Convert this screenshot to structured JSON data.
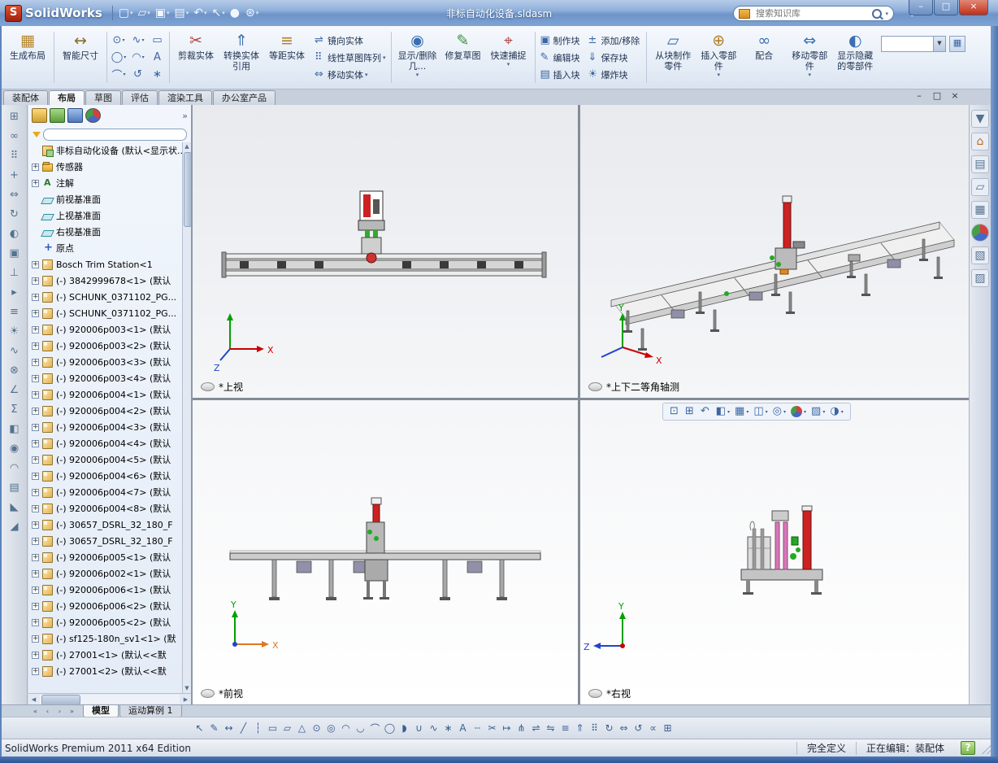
{
  "titlebar": {
    "app_name": "SolidWorks",
    "doc_title": "非标自动化设备.sldasm",
    "search_placeholder": "搜索知识库",
    "help_label": "?",
    "buttons": [
      {
        "name": "new-document-button",
        "glyph": "▢",
        "arrow": "▾"
      },
      {
        "name": "open-document-button",
        "glyph": "▱",
        "arrow": "▾"
      },
      {
        "name": "save-document-button",
        "glyph": "▣",
        "arrow": "▾"
      },
      {
        "name": "print-button",
        "glyph": "▤",
        "arrow": "▾"
      },
      {
        "name": "undo-button",
        "glyph": "↶",
        "arrow": "▾"
      },
      {
        "name": "select-button",
        "glyph": "↖",
        "arrow": "▾"
      },
      {
        "name": "rebuild-button",
        "glyph": "●",
        "arrow": ""
      },
      {
        "name": "options-button",
        "glyph": "⊛",
        "arrow": "▾"
      }
    ],
    "window_buttons": [
      {
        "name": "minimize-button",
        "glyph": "–",
        "cls": ""
      },
      {
        "name": "maximize-button",
        "glyph": "□",
        "cls": ""
      },
      {
        "name": "close-button",
        "glyph": "×",
        "cls": "close"
      }
    ]
  },
  "ribbon": {
    "g1": [
      {
        "name": "create-layout-button",
        "glyph": "▦",
        "color": "#b5862e",
        "label": "生成布局",
        "arrow": ""
      }
    ],
    "g2": [
      {
        "name": "smart-dimension-button",
        "glyph": "↔",
        "color": "#8a6d2f",
        "label": "智能尺寸",
        "arrow": ""
      }
    ],
    "grid": [
      {
        "name": "circle-tool-icon",
        "glyph": "⊙",
        "arrow": "▾"
      },
      {
        "name": "spline-tool-icon",
        "glyph": "∿",
        "arrow": "▾"
      },
      {
        "name": "rectangle-tool-icon",
        "glyph": "▭",
        "arrow": ""
      },
      {
        "name": "ellipse-tool-icon",
        "glyph": "◯",
        "arrow": "▾"
      },
      {
        "name": "arc-tool-icon",
        "glyph": "◠",
        "arrow": "▾"
      },
      {
        "name": "text-tool-icon",
        "glyph": "A",
        "arrow": ""
      },
      {
        "name": "slot-tool-icon",
        "glyph": "⌒",
        "arrow": "▾"
      },
      {
        "name": "erase-tool-icon",
        "glyph": "↺",
        "arrow": ""
      },
      {
        "name": "point-tool-icon",
        "glyph": "∗",
        "arrow": ""
      }
    ],
    "g4": [
      {
        "name": "trim-entities-button",
        "glyph": "✂",
        "color": "#b04040",
        "label": "剪裁实体",
        "arrow": ""
      },
      {
        "name": "convert-entities-button",
        "glyph": "⇑",
        "color": "#3a6fb0",
        "label": "转换实体引用",
        "arrow": ""
      },
      {
        "name": "offset-entities-button",
        "glyph": "≡",
        "color": "#b08030",
        "label": "等距实体",
        "arrow": ""
      }
    ],
    "g5": [
      {
        "name": "mirror-entities-button",
        "glyph": "⇌",
        "label": "镜向实体",
        "arrow": ""
      },
      {
        "name": "linear-sketch-pattern-button",
        "glyph": "⠿",
        "label": "线性草图阵列",
        "arrow": "▾"
      },
      {
        "name": "move-entities-button",
        "glyph": "⇔",
        "label": "移动实体",
        "arrow": "▾"
      }
    ],
    "g6": [
      {
        "name": "display-delete-relations-button",
        "glyph": "◉",
        "color": "#3a6fb0",
        "label": "显示/删除几...",
        "arrow": "▾"
      },
      {
        "name": "repair-sketch-button",
        "glyph": "✎",
        "color": "#3f8f3f",
        "label": "修复草图",
        "arrow": ""
      },
      {
        "name": "quick-snaps-button",
        "glyph": "⌖",
        "color": "#b04040",
        "label": "快速捕捉",
        "arrow": "▾"
      }
    ],
    "g7": [
      {
        "name": "make-block-button",
        "glyph": "▣",
        "label": "制作块",
        "arrow": ""
      },
      {
        "name": "edit-block-button",
        "glyph": "✎",
        "label": "编辑块",
        "arrow": ""
      },
      {
        "name": "insert-block-button",
        "glyph": "▤",
        "label": "插入块",
        "arrow": ""
      }
    ],
    "g8": [
      {
        "name": "add-remove-block-button",
        "glyph": "±",
        "label": "添加/移除",
        "arrow": ""
      },
      {
        "name": "save-block-button",
        "glyph": "⇓",
        "label": "保存块",
        "arrow": ""
      },
      {
        "name": "explode-block-button",
        "glyph": "☀",
        "label": "爆炸块",
        "arrow": ""
      }
    ],
    "g9": [
      {
        "name": "make-part-from-block-button",
        "glyph": "▱",
        "color": "#3a6fb0",
        "label": "从块制作零件",
        "arrow": ""
      },
      {
        "name": "insert-components-button",
        "glyph": "⊕",
        "color": "#b08030",
        "label": "插入零部件",
        "arrow": "▾"
      },
      {
        "name": "mate-button",
        "glyph": "∞",
        "color": "#3a6fb0",
        "label": "配合",
        "arrow": ""
      },
      {
        "name": "move-component-button",
        "glyph": "⇔",
        "color": "#3a6fb0",
        "label": "移动零部件",
        "arrow": "▾"
      },
      {
        "name": "show-hidden-components-button",
        "glyph": "◐",
        "color": "#3a6fb0",
        "label": "显示隐藏的零部件",
        "arrow": ""
      }
    ]
  },
  "mode_tabs": [
    {
      "label": "装配体",
      "cls": ""
    },
    {
      "label": "布局",
      "cls": "active"
    },
    {
      "label": "草图",
      "cls": ""
    },
    {
      "label": "评估",
      "cls": ""
    },
    {
      "label": "渲染工具",
      "cls": ""
    },
    {
      "label": "办公室产品",
      "cls": ""
    }
  ],
  "doc_window_buttons": [
    {
      "name": "doc-minimize-button",
      "glyph": "–"
    },
    {
      "name": "doc-restore-button",
      "glyph": "□"
    },
    {
      "name": "doc-close-button",
      "glyph": "×"
    }
  ],
  "left_toolbar": {
    "icons": [
      {
        "name": "insert-component-icon",
        "glyph": "⊞"
      },
      {
        "name": "mate-icon",
        "glyph": "∞"
      },
      {
        "name": "component-pattern-icon",
        "glyph": "⠿"
      },
      {
        "name": "smart-fasteners-icon",
        "glyph": "+"
      },
      {
        "name": "move-component-icon",
        "glyph": "⇔"
      },
      {
        "name": "rotate-component-icon",
        "glyph": "↻"
      },
      {
        "name": "show-hidden-icon",
        "glyph": "◐"
      },
      {
        "name": "assembly-features-icon",
        "glyph": "▣"
      },
      {
        "name": "reference-geometry-icon",
        "glyph": "⊥"
      },
      {
        "name": "motion-study-icon",
        "glyph": "▸"
      },
      {
        "name": "bill-of-materials-icon",
        "glyph": "≡"
      },
      {
        "name": "exploded-view-icon",
        "glyph": "☀"
      },
      {
        "name": "explode-line-sketch-icon",
        "glyph": "∿"
      },
      {
        "name": "interference-detection-icon",
        "glyph": "⊗"
      },
      {
        "name": "measure-icon",
        "glyph": "∠"
      },
      {
        "name": "mass-properties-icon",
        "glyph": "Σ"
      },
      {
        "name": "section-view-icon",
        "glyph": "◧"
      },
      {
        "name": "sensor-icon",
        "glyph": "◉"
      },
      {
        "name": "curvature-icon",
        "glyph": "◠"
      },
      {
        "name": "zebra-stripes-icon",
        "glyph": "▤"
      },
      {
        "name": "draft-analysis-icon",
        "glyph": "◣"
      },
      {
        "name": "undercut-analysis-icon",
        "glyph": "◢"
      }
    ]
  },
  "feature_tree": {
    "header_tabs": [
      {
        "name": "featuremanager-tab",
        "cls": "th-fm",
        "glyph": ""
      },
      {
        "name": "propertymanager-tab",
        "cls": "th-pm",
        "glyph": ""
      },
      {
        "name": "configurationmanager-tab",
        "cls": "th-cm",
        "glyph": ""
      },
      {
        "name": "displaymanager-tab",
        "cls": "th-dm",
        "glyph": ""
      }
    ],
    "more_label": "»",
    "root": {
      "label": "非标自动化设备 (默认<显示状..."
    },
    "items": [
      {
        "icon": "folder",
        "plus": "+",
        "label": "传感器"
      },
      {
        "icon": "note",
        "plus": "+",
        "label": "注解"
      },
      {
        "icon": "plane",
        "plus": "",
        "label": "前视基准面"
      },
      {
        "icon": "plane",
        "plus": "",
        "label": "上视基准面"
      },
      {
        "icon": "plane",
        "plus": "",
        "label": "右视基准面"
      },
      {
        "icon": "origin",
        "plus": "",
        "label": "原点"
      },
      {
        "icon": "part",
        "plus": "+",
        "label": "Bosch Trim Station<1"
      },
      {
        "icon": "part",
        "plus": "+",
        "label": "(-) 3842999678<1> (默认"
      },
      {
        "icon": "part",
        "plus": "+",
        "label": "(-) SCHUNK_0371102_PG..."
      },
      {
        "icon": "part",
        "plus": "+",
        "label": "(-) SCHUNK_0371102_PG..."
      },
      {
        "icon": "part",
        "plus": "+",
        "label": "(-) 920006p003<1> (默认"
      },
      {
        "icon": "part",
        "plus": "+",
        "label": "(-) 920006p003<2> (默认"
      },
      {
        "icon": "part",
        "plus": "+",
        "label": "(-) 920006p003<3> (默认"
      },
      {
        "icon": "part",
        "plus": "+",
        "label": "(-) 920006p003<4> (默认"
      },
      {
        "icon": "part",
        "plus": "+",
        "label": "(-) 920006p004<1> (默认"
      },
      {
        "icon": "part",
        "plus": "+",
        "label": "(-) 920006p004<2> (默认"
      },
      {
        "icon": "part",
        "plus": "+",
        "label": "(-) 920006p004<3> (默认"
      },
      {
        "icon": "part",
        "plus": "+",
        "label": "(-) 920006p004<4> (默认"
      },
      {
        "icon": "part",
        "plus": "+",
        "label": "(-) 920006p004<5> (默认"
      },
      {
        "icon": "part",
        "plus": "+",
        "label": "(-) 920006p004<6> (默认"
      },
      {
        "icon": "part",
        "plus": "+",
        "label": "(-) 920006p004<7> (默认"
      },
      {
        "icon": "part",
        "plus": "+",
        "label": "(-) 920006p004<8> (默认"
      },
      {
        "icon": "part",
        "plus": "+",
        "label": "(-) 30657_DSRL_32_180_F"
      },
      {
        "icon": "part",
        "plus": "+",
        "label": "(-) 30657_DSRL_32_180_F"
      },
      {
        "icon": "part",
        "plus": "+",
        "label": "(-) 920006p005<1> (默认"
      },
      {
        "icon": "part",
        "plus": "+",
        "label": "(-) 920006p002<1> (默认"
      },
      {
        "icon": "part",
        "plus": "+",
        "label": "(-) 920006p006<1> (默认"
      },
      {
        "icon": "part",
        "plus": "+",
        "label": "(-) 920006p006<2> (默认"
      },
      {
        "icon": "part",
        "plus": "+",
        "label": "(-) 920006p005<2> (默认"
      },
      {
        "icon": "part",
        "plus": "+",
        "label": "(-) sf125-180n_sv1<1> (默"
      },
      {
        "icon": "part",
        "plus": "+",
        "label": "(-) 27001<1> (默认<<默"
      },
      {
        "icon": "part",
        "plus": "+",
        "label": "(-) 27001<2> (默认<<默"
      }
    ]
  },
  "viewport": {
    "labels": {
      "top_left": "*上视",
      "top_right": "*上下二等角轴测",
      "bottom_left": "*前视",
      "bottom_right": "*右视"
    },
    "axis": {
      "x": "X",
      "y": "Y",
      "z": "Z"
    },
    "hud": [
      {
        "name": "zoom-fit-icon",
        "glyph": "⊡",
        "cls": "",
        "arrow": ""
      },
      {
        "name": "zoom-area-icon",
        "glyph": "⊞",
        "cls": "",
        "arrow": ""
      },
      {
        "name": "previous-view-icon",
        "glyph": "↶",
        "cls": "",
        "arrow": ""
      },
      {
        "name": "section-view-icon",
        "glyph": "◧",
        "cls": "",
        "arrow": "▾"
      },
      {
        "name": "view-orientation-icon",
        "glyph": "▦",
        "cls": "",
        "arrow": "▾"
      },
      {
        "name": "display-style-icon",
        "glyph": "◫",
        "cls": "",
        "arrow": "▾"
      },
      {
        "name": "hide-show-items-icon",
        "glyph": "◎",
        "cls": "",
        "arrow": "▾"
      },
      {
        "name": "edit-appearance-icon",
        "glyph": "",
        "cls": "ball",
        "arrow": "▾"
      },
      {
        "name": "apply-scene-icon",
        "glyph": "▨",
        "cls": "",
        "arrow": "▾"
      },
      {
        "name": "view-settings-icon",
        "glyph": "◑",
        "cls": "",
        "arrow": "▾"
      }
    ]
  },
  "task_pane": {
    "icons": [
      {
        "name": "auto-hide-pin-icon",
        "glyph": "▼",
        "cls": ""
      },
      {
        "name": "solidworks-resources-icon",
        "glyph": "⌂",
        "cls": "home"
      },
      {
        "name": "design-library-icon",
        "glyph": "▤",
        "cls": ""
      },
      {
        "name": "file-explorer-icon",
        "glyph": "▱",
        "cls": ""
      },
      {
        "name": "view-palette-icon",
        "glyph": "▦",
        "cls": ""
      },
      {
        "name": "appearances-scenes-icon",
        "glyph": "",
        "cls": "ball"
      },
      {
        "name": "custom-properties-icon",
        "glyph": "▧",
        "cls": ""
      },
      {
        "name": "document-recovery-icon",
        "glyph": "▨",
        "cls": ""
      }
    ]
  },
  "bottom": {
    "nav": [
      {
        "name": "first-tab-button",
        "glyph": "«"
      },
      {
        "name": "prev-tab-button",
        "glyph": "‹"
      },
      {
        "name": "next-tab-button",
        "glyph": "›"
      },
      {
        "name": "last-tab-button",
        "glyph": "»"
      }
    ],
    "tabs": [
      {
        "label": "模型",
        "cls": "active"
      },
      {
        "label": "运动算例 1",
        "cls": ""
      }
    ],
    "toolbar_icons": [
      {
        "name": "select-icon",
        "glyph": "↖"
      },
      {
        "name": "sketch-icon",
        "glyph": "✎"
      },
      {
        "name": "smart-dimension-icon",
        "glyph": "↔"
      },
      {
        "name": "line-icon",
        "glyph": "╱"
      },
      {
        "name": "centerline-icon",
        "glyph": "┆"
      },
      {
        "name": "rectangle-icon",
        "glyph": "▭"
      },
      {
        "name": "parallelogram-icon",
        "glyph": "▱"
      },
      {
        "name": "polygon-icon",
        "glyph": "△"
      },
      {
        "name": "circle-icon",
        "glyph": "⊙"
      },
      {
        "name": "perimeter-circle-icon",
        "glyph": "◎"
      },
      {
        "name": "centerpoint-arc-icon",
        "glyph": "◠"
      },
      {
        "name": "tangent-arc-icon",
        "glyph": "◡"
      },
      {
        "name": "three-point-arc-icon",
        "glyph": "⌒"
      },
      {
        "name": "ellipse-icon",
        "glyph": "◯"
      },
      {
        "name": "partial-ellipse-icon",
        "glyph": "◗"
      },
      {
        "name": "parabola-icon",
        "glyph": "∪"
      },
      {
        "name": "spline-icon",
        "glyph": "∿"
      },
      {
        "name": "point-icon",
        "glyph": "∗"
      },
      {
        "name": "text-icon",
        "glyph": "A"
      },
      {
        "name": "construction-geometry-icon",
        "glyph": "┄"
      },
      {
        "name": "trim-icon",
        "glyph": "✂"
      },
      {
        "name": "extend-icon",
        "glyph": "↦"
      },
      {
        "name": "split-entities-icon",
        "glyph": "⋔"
      },
      {
        "name": "mirror-icon",
        "glyph": "⇌"
      },
      {
        "name": "dynamic-mirror-icon",
        "glyph": "⇋"
      },
      {
        "name": "offset-icon",
        "glyph": "≡"
      },
      {
        "name": "convert-icon",
        "glyph": "⇑"
      },
      {
        "name": "linear-pattern-icon",
        "glyph": "⠿"
      },
      {
        "name": "circular-pattern-icon",
        "glyph": "↻"
      },
      {
        "name": "move-icon",
        "glyph": "⇔"
      },
      {
        "name": "rotate-icon",
        "glyph": "↺"
      },
      {
        "name": "scale-icon",
        "glyph": "∝"
      },
      {
        "name": "modify-icon",
        "glyph": "⊞"
      }
    ]
  },
  "statusbar": {
    "edition": "SolidWorks Premium 2011 x64 Edition",
    "defined_state": "完全定义",
    "editing_state": "正在编辑：装配体",
    "help_glyph": "?"
  }
}
